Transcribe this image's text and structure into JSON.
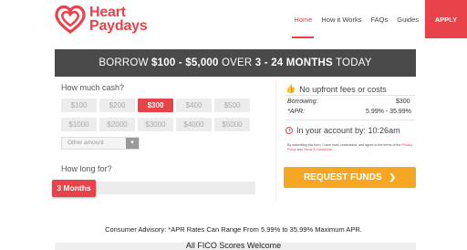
{
  "brand": {
    "line1": "Heart",
    "line2": "Paydays",
    "accent": "#e8424a",
    "cta_color": "#f5a623"
  },
  "nav": {
    "items": [
      {
        "label": "Home",
        "active": true
      },
      {
        "label": "How it Works"
      },
      {
        "label": "FAQs"
      },
      {
        "label": "Guides"
      }
    ],
    "apply_label": "APPLY"
  },
  "banner": {
    "prefix": "BORROW ",
    "amount": "$100 - $5,000",
    "middle": " OVER ",
    "term": "3 - 24 MONTHS",
    "suffix": " TODAY"
  },
  "amount": {
    "label": "How much cash?",
    "options": [
      "$100",
      "$200",
      "$300",
      "$400",
      "$500",
      "$1000",
      "$2000",
      "$3000",
      "$4000",
      "$5000"
    ],
    "selected": "$300",
    "other_placeholder": "Other amount"
  },
  "term": {
    "label": "How long for?",
    "value": "3 Months"
  },
  "summary": {
    "fees_text": "No upfront fees or costs",
    "borrowing_label": "Borrowing:",
    "borrowing_value": "$300",
    "apr_label": "*APR:",
    "apr_value": "5.99% - 35.99%",
    "account_text": "In your account by:  10:26am"
  },
  "legal": {
    "text": "By submitting this form, I have read, understand, and agree to the terms of the ",
    "privacy": "Privacy Policy",
    "and": " and ",
    "terms": "Terms & Conditions",
    "end": "."
  },
  "cta": {
    "label": "REQUEST FUNDS",
    "arrow": "❯"
  },
  "advisory": "Consumer Advisory: *APR Rates Can Range From 5.99% to 35.99% Maximum APR.",
  "bottom_title": "All FICO Scores Welcome"
}
